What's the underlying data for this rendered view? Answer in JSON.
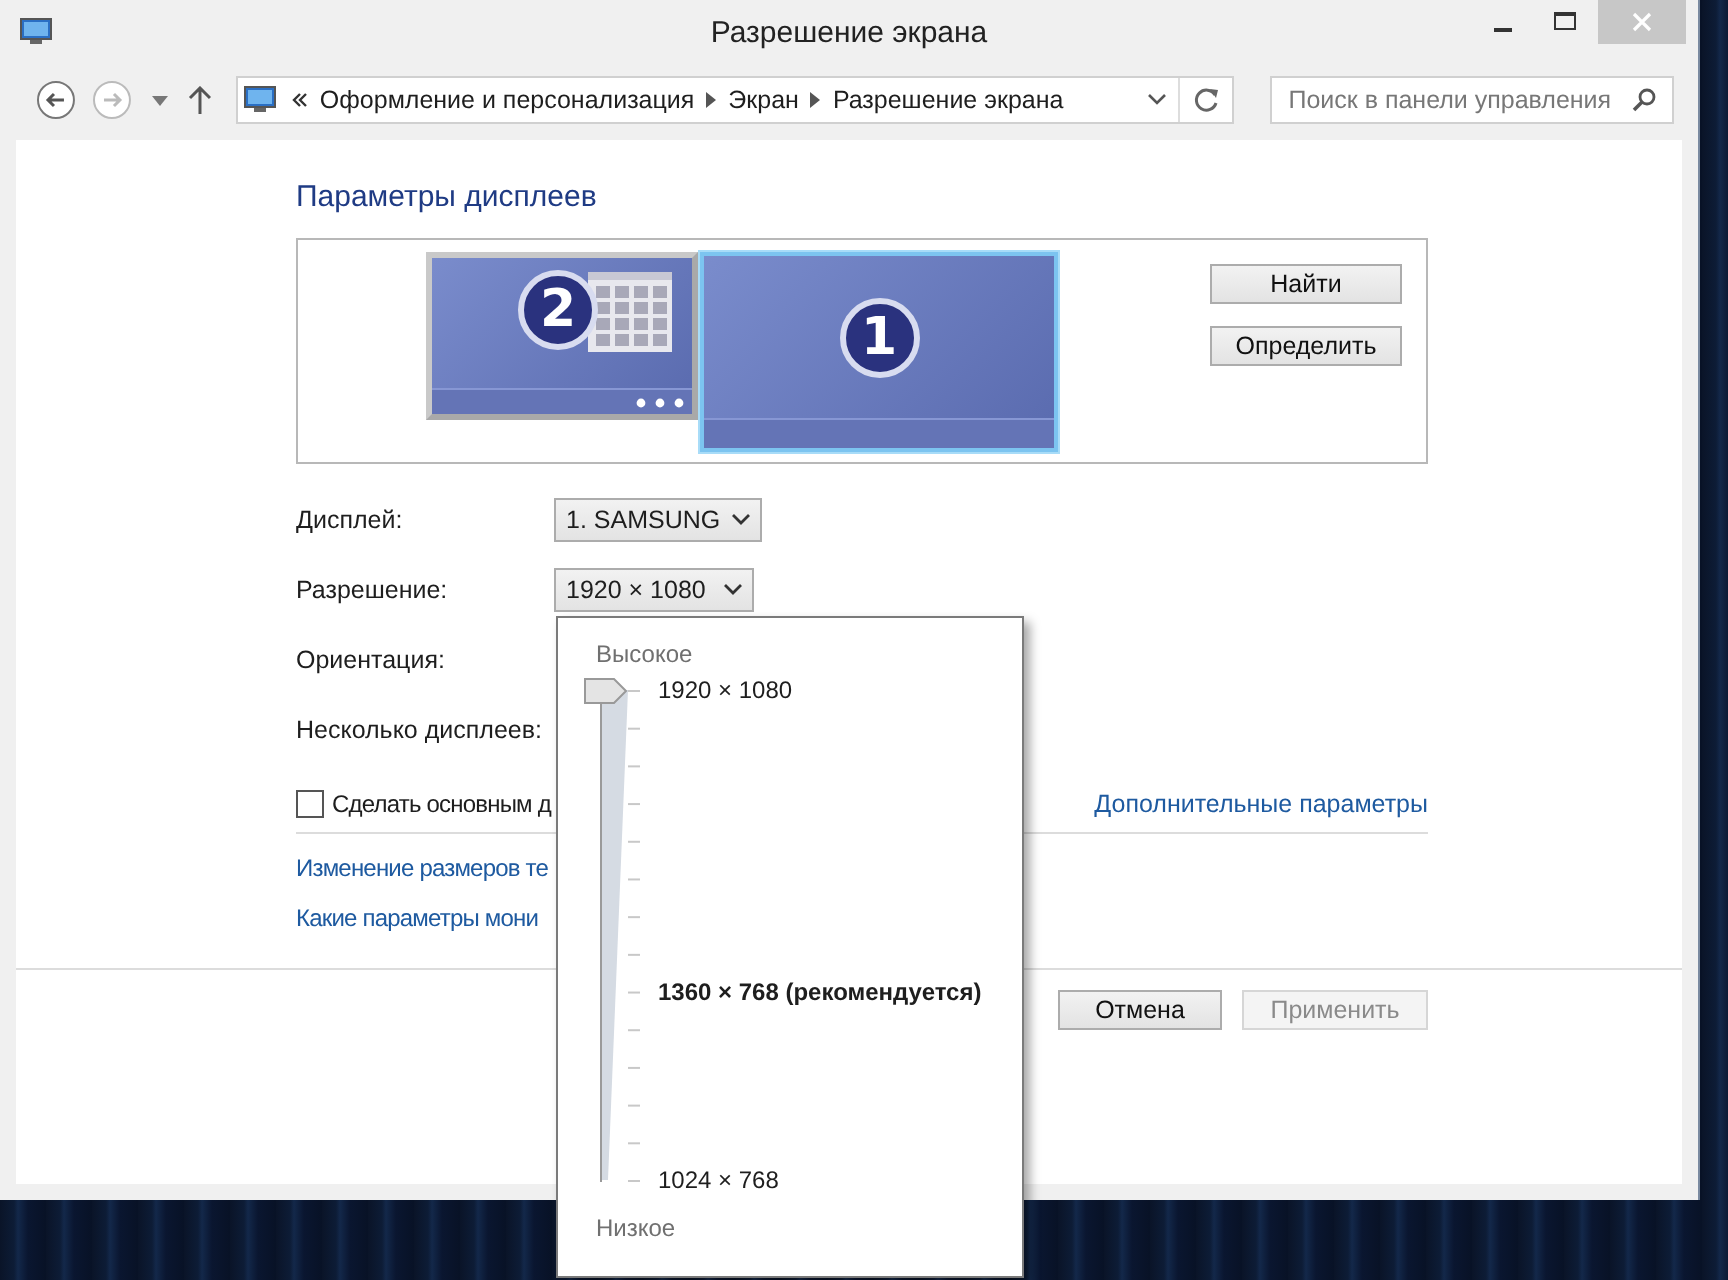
{
  "window": {
    "title": "Разрешение экрана"
  },
  "address_bar": {
    "breadcrumbs": [
      "Оформление и персонализация",
      "Экран",
      "Разрешение экрана"
    ]
  },
  "search": {
    "placeholder": "Поиск в панели управления"
  },
  "heading": "Параметры дисплеев",
  "monitors": [
    {
      "number": "2",
      "selected": false
    },
    {
      "number": "1",
      "selected": true
    }
  ],
  "monitor_buttons": [
    "Найти",
    "Определить"
  ],
  "settings": [
    {
      "label": "Дисплей:",
      "value": "1. SAMSUNG"
    },
    {
      "label": "Разрешение:",
      "value": "1920 × 1080"
    },
    {
      "label": "Ориентация:"
    },
    {
      "label": "Несколько дисплеев:"
    }
  ],
  "primary_checkbox": {
    "label": "Сделать основным д",
    "checked": false
  },
  "advanced_link": "Дополнительные параметры",
  "links": [
    "Изменение размеров те",
    "Какие параметры мони"
  ],
  "buttons": [
    {
      "label": "Отмена",
      "disabled": false
    },
    {
      "label": "Применить",
      "disabled": true
    }
  ],
  "resolution_popup": {
    "high_label": "Высокое",
    "low_label": "Низкое",
    "level": 1,
    "marks": [
      {
        "label": "1920 × 1080",
        "recommended": false
      },
      {
        "label": "1360 × 768 (рекомендуется)",
        "recommended": true
      },
      {
        "label": "1024 × 768",
        "recommended": false
      }
    ]
  }
}
